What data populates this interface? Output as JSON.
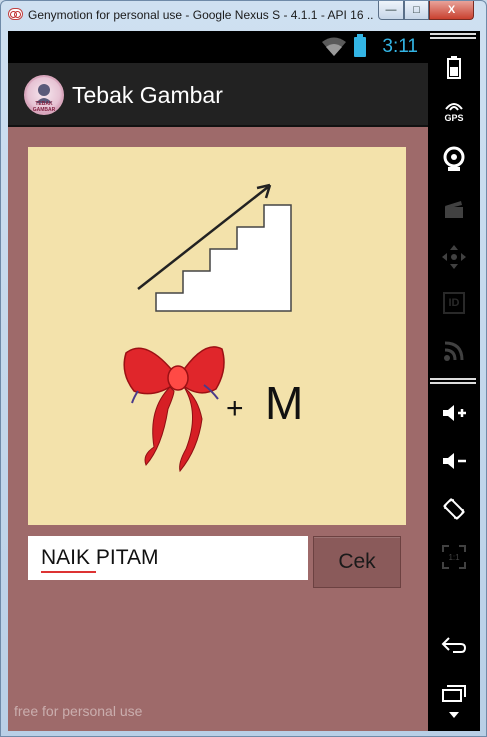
{
  "window": {
    "title": "Genymotion for personal use - Google Nexus S - 4.1.1 - API 16 ...",
    "minimize_label": "—",
    "maximize_label": "□",
    "close_label": "X"
  },
  "statusbar": {
    "time": "3:11"
  },
  "actionbar": {
    "logo_text": "TEBAK GAMBAR",
    "title": "Tebak Gambar"
  },
  "puzzle": {
    "plus_text": "+",
    "letter_text": "M"
  },
  "answer": {
    "value": "NAIK PITAM",
    "check_label": "Cek"
  },
  "watermark": "free for personal use",
  "sidebar": {
    "gps_label": "GPS",
    "id_label": "ID"
  },
  "colors": {
    "screen_background": "#9e6a6a",
    "puzzle_background": "#f3e2ab",
    "status_accent": "#33b5e5",
    "actionbar": "#222222"
  }
}
